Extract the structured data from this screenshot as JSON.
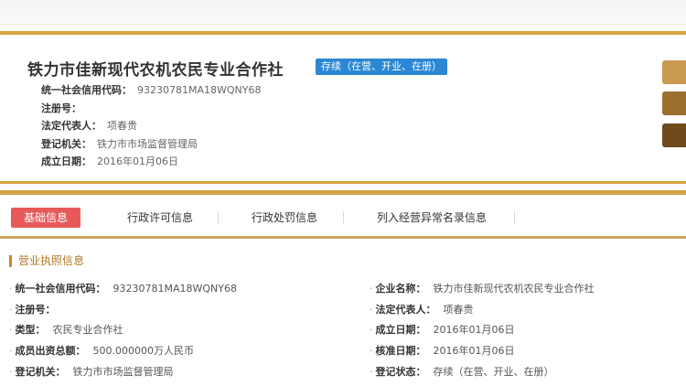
{
  "header": {
    "company_name": "铁力市佳新现代农机农民专业合作社",
    "status_badge": "存续（在营、开业、在册）",
    "rows": [
      {
        "label": "统一社会信用代码：",
        "value": "93230781MA18WQNY68"
      },
      {
        "label": "注册号：",
        "value": ""
      },
      {
        "label": "法定代表人：",
        "value": "项春贵"
      },
      {
        "label": "登记机关：",
        "value": "铁力市市场监督管理局"
      },
      {
        "label": "成立日期：",
        "value": "2016年01月06日"
      }
    ]
  },
  "tabs": [
    {
      "label": "基础信息",
      "active": true
    },
    {
      "label": "行政许可信息",
      "active": false
    },
    {
      "label": "行政处罚信息",
      "active": false
    },
    {
      "label": "列入经营异常名录信息",
      "active": false
    }
  ],
  "section": {
    "title": "营业执照信息",
    "left": [
      {
        "label": "统一社会信用代码：",
        "value": "93230781MA18WQNY68"
      },
      {
        "label": "注册号：",
        "value": ""
      },
      {
        "label": "类型：",
        "value": "农民专业合作社"
      },
      {
        "label": "成员出资总额：",
        "value": "500.000000万人民币"
      },
      {
        "label": "登记机关：",
        "value": "铁力市市场监督管理局"
      }
    ],
    "right": [
      {
        "label": "企业名称：",
        "value": "铁力市佳新现代农机农民专业合作社"
      },
      {
        "label": "法定代表人：",
        "value": "项春贵"
      },
      {
        "label": "成立日期：",
        "value": "2016年01月06日"
      },
      {
        "label": "核准日期：",
        "value": "2016年01月06日"
      },
      {
        "label": "登记状态：",
        "value": "存续（在营、开业、在册）"
      }
    ]
  },
  "colors": {
    "gold": "#d9a441",
    "badge_blue": "#2b87d3",
    "active_tab": "#e85a5a"
  }
}
